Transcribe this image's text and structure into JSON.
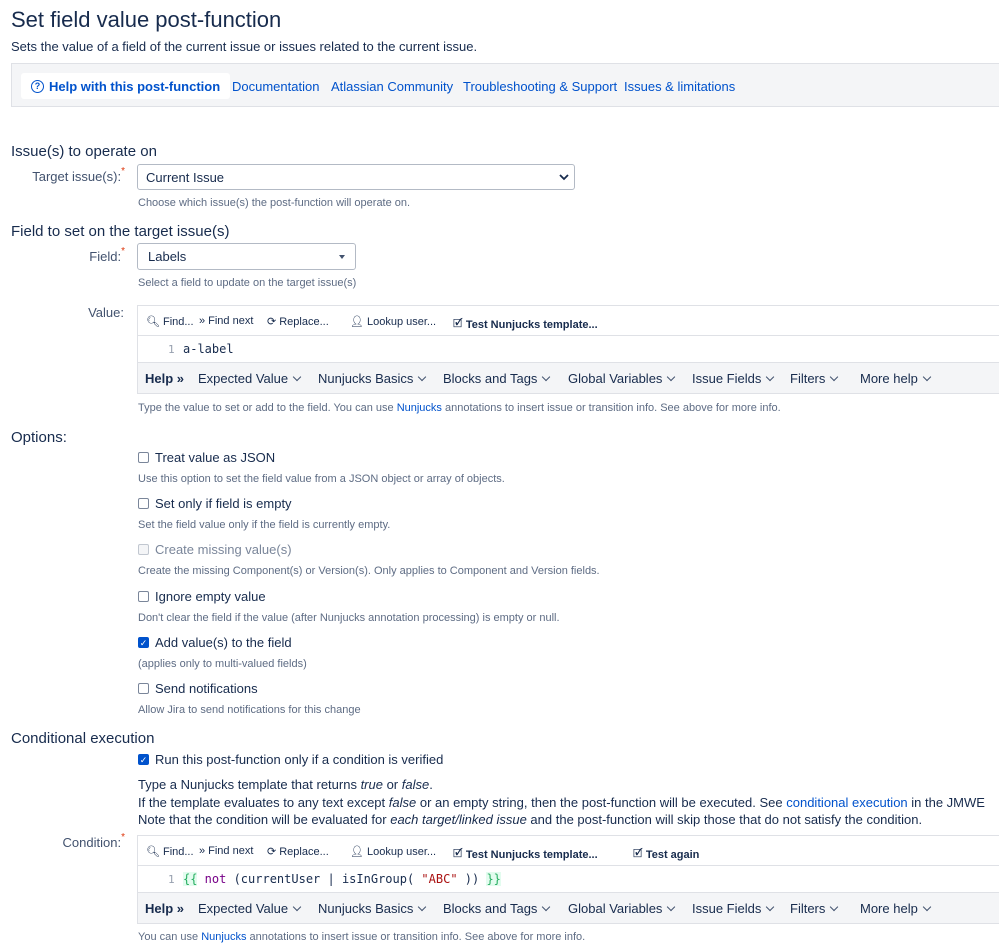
{
  "page": {
    "title": "Set field value post-function",
    "subtitle": "Sets the value of a field of the current issue or issues related to the current issue."
  },
  "help_bar": {
    "active_tab": "Help with this post-function",
    "links": [
      "Documentation",
      "Atlassian Community",
      "Troubleshooting & Support",
      "Issues & limitations"
    ]
  },
  "issues_section": {
    "heading": "Issue(s) to operate on",
    "label": "Target issue(s):",
    "selected": "Current Issue",
    "description": "Choose which issue(s) the post-function will operate on."
  },
  "field_section": {
    "heading": "Field to set on the target issue(s)",
    "label": "Field:",
    "selected": "Labels",
    "description": "Select a field to update on the target issue(s)"
  },
  "value_editor": {
    "label": "Value:",
    "toolbar": [
      "Find...",
      "Find next",
      "Replace...",
      "Lookup user...",
      "Test Nunjucks template..."
    ],
    "line_number": "1",
    "code": "a-label",
    "help_label": "Help",
    "help_menus": [
      "Expected Value",
      "Nunjucks Basics",
      "Blocks and Tags",
      "Global Variables",
      "Issue Fields",
      "Filters",
      "More help"
    ],
    "description_before": "Type the value to set or add to the field. You can use ",
    "description_link": "Nunjucks",
    "description_after": " annotations to insert issue or transition info. See above for more info."
  },
  "options": {
    "heading": "Options:",
    "items": [
      {
        "label": "Treat value as JSON",
        "description": "Use this option to set the field value from a JSON object or array of objects.",
        "checked": false,
        "disabled": false
      },
      {
        "label": "Set only if field is empty",
        "description": "Set the field value only if the field is currently empty.",
        "checked": false,
        "disabled": false
      },
      {
        "label": "Create missing value(s)",
        "description": "Create the missing Component(s) or Version(s). Only applies to Component and Version fields.",
        "checked": false,
        "disabled": true
      },
      {
        "label": "Ignore empty value",
        "description": "Don't clear the field if the value (after Nunjucks annotation processing) is empty or null.",
        "checked": false,
        "disabled": false
      },
      {
        "label": "Add value(s) to the field",
        "description": "(applies only to multi-valued fields)",
        "checked": true,
        "disabled": false
      },
      {
        "label": "Send notifications",
        "description": "Allow Jira to send notifications for this change",
        "checked": false,
        "disabled": false
      }
    ]
  },
  "conditional": {
    "heading": "Conditional execution",
    "checkbox_label": "Run this post-function only if a condition is verified",
    "checked": true,
    "line1_a": "Type a Nunjucks template that returns ",
    "line1_true": "true",
    "line1_or": " or ",
    "line1_false": "false",
    "line1_end": ".",
    "line2_a": "If the template evaluates to any text except ",
    "line2_false": "false",
    "line2_b": " or an empty string, then the post-function will be executed. See ",
    "line2_link": "conditional execution",
    "line2_c": " in the JMWE",
    "line3_a": "Note that the condition will be evaluated for ",
    "line3_em": "each target/linked issue",
    "line3_b": " and the post-function will skip those that do not satisfy the condition.",
    "label": "Condition:",
    "toolbar": [
      "Find...",
      "Find next",
      "Replace...",
      "Lookup user...",
      "Test Nunjucks template...",
      "Test again"
    ],
    "line_number": "1",
    "code_tokens": [
      "{{",
      " not ",
      "(currentUser | isInGroup( ",
      "\"ABC\"",
      " )) ",
      "}}"
    ],
    "help_label": "Help",
    "help_menus": [
      "Expected Value",
      "Nunjucks Basics",
      "Blocks and Tags",
      "Global Variables",
      "Issue Fields",
      "Filters",
      "More help"
    ],
    "description_before": "You can use ",
    "description_link": "Nunjucks",
    "description_after": " annotations to insert issue or transition info. See above for more info."
  },
  "colors": {
    "link": "#0052cc",
    "checkbox": "#0052cc",
    "required": "#de350b",
    "keyword": "#770088",
    "string": "#aa1111",
    "brace_bg": "#e3fcef"
  }
}
